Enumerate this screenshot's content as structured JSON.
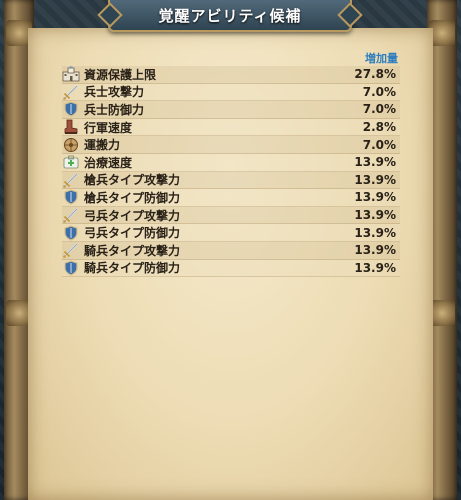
{
  "title": "覚醒アビリティ候補",
  "column_header": "増加量",
  "rows": [
    {
      "icon": "castle-icon",
      "name": "資源保護上限",
      "value": "27.8%"
    },
    {
      "icon": "sword-icon",
      "name": "兵士攻撃力",
      "value": "7.0%"
    },
    {
      "icon": "shield-icon",
      "name": "兵士防御力",
      "value": "7.0%"
    },
    {
      "icon": "boot-icon",
      "name": "行軍速度",
      "value": "2.8%"
    },
    {
      "icon": "cart-icon",
      "name": "運搬力",
      "value": "7.0%"
    },
    {
      "icon": "medkit-icon",
      "name": "治療速度",
      "value": "13.9%"
    },
    {
      "icon": "sword-icon",
      "name": "槍兵タイプ攻撃力",
      "value": "13.9%"
    },
    {
      "icon": "shield-icon",
      "name": "槍兵タイプ防御力",
      "value": "13.9%"
    },
    {
      "icon": "sword-icon",
      "name": "弓兵タイプ攻撃力",
      "value": "13.9%"
    },
    {
      "icon": "shield-icon",
      "name": "弓兵タイプ防御力",
      "value": "13.9%"
    },
    {
      "icon": "sword-icon",
      "name": "騎兵タイプ攻撃力",
      "value": "13.9%"
    },
    {
      "icon": "shield-icon",
      "name": "騎兵タイプ防御力",
      "value": "13.9%"
    }
  ]
}
